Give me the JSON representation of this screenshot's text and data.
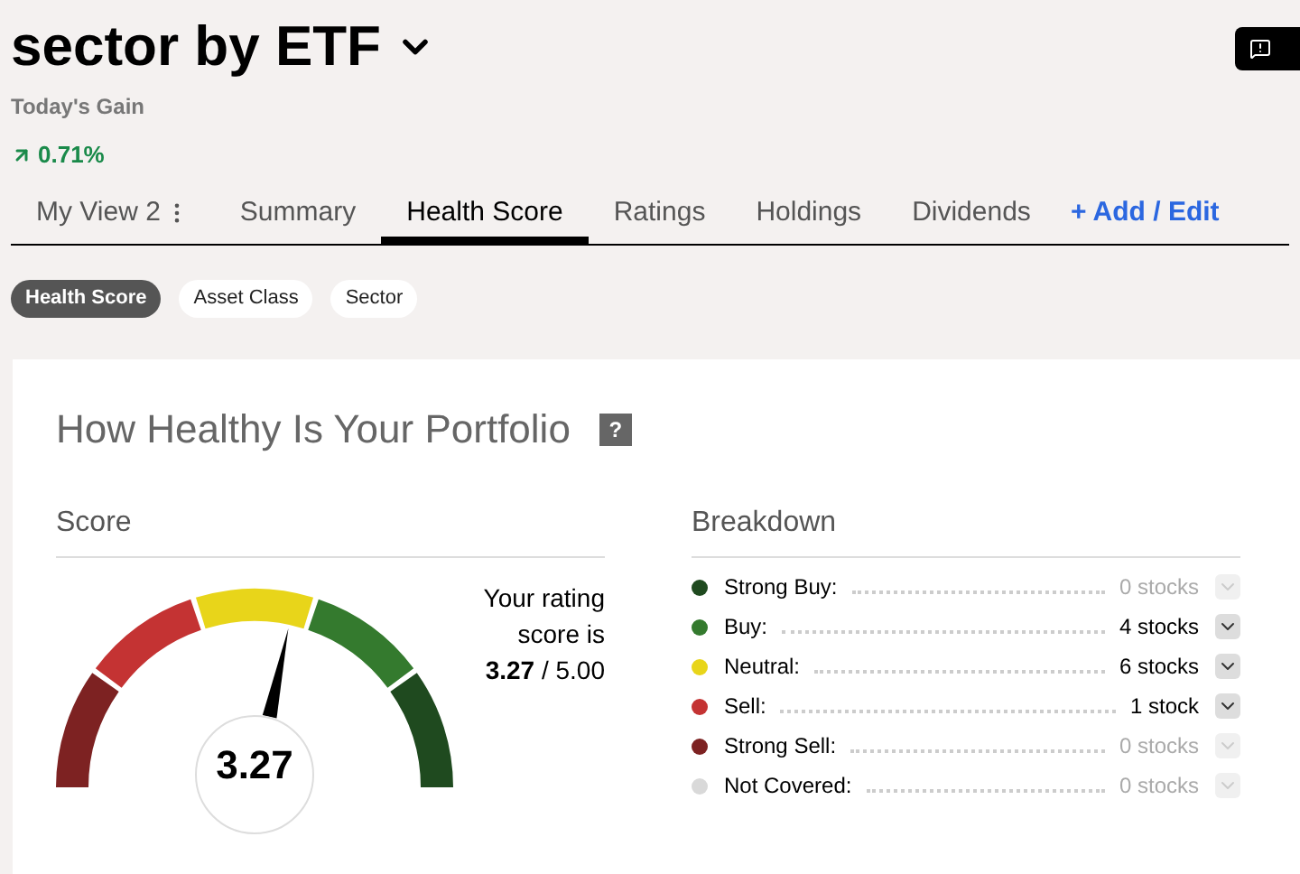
{
  "header": {
    "title": "sector by ETF",
    "gain_label": "Today's Gain",
    "gain_value": "0.71%"
  },
  "tabs": [
    {
      "label": "My View 2",
      "selected": false,
      "kind": "menu"
    },
    {
      "label": "Summary",
      "selected": false,
      "kind": "plain"
    },
    {
      "label": "Health Score",
      "selected": true,
      "kind": "plain"
    },
    {
      "label": "Ratings",
      "selected": false,
      "kind": "plain"
    },
    {
      "label": "Holdings",
      "selected": false,
      "kind": "plain"
    },
    {
      "label": "Dividends",
      "selected": false,
      "kind": "plain"
    }
  ],
  "add_edit": "+ Add / Edit",
  "chips": [
    {
      "label": "Health Score",
      "selected": true
    },
    {
      "label": "Asset Class",
      "selected": false
    },
    {
      "label": "Sector",
      "selected": false
    }
  ],
  "card": {
    "title": "How Healthy Is Your Portfolio",
    "help": "?",
    "score": {
      "heading": "Score",
      "value": "3.27",
      "rating_text": "Your rating score is",
      "rating_value": "3.27",
      "rating_max": "/ 5.00"
    },
    "breakdown": {
      "heading": "Breakdown",
      "rows": [
        {
          "label": "Strong Buy:",
          "count": "0 stocks",
          "color": "#1f4a1f",
          "disabled": true
        },
        {
          "label": "Buy:",
          "count": "4 stocks",
          "color": "#347a2e",
          "disabled": false
        },
        {
          "label": "Neutral:",
          "count": "6 stocks",
          "color": "#e8d51a",
          "disabled": false
        },
        {
          "label": "Sell:",
          "count": "1 stock",
          "color": "#c43333",
          "disabled": false
        },
        {
          "label": "Strong Sell:",
          "count": "0 stocks",
          "color": "#7d2222",
          "disabled": true
        },
        {
          "label": "Not Covered:",
          "count": "0 stocks",
          "color": "#d9d9d9",
          "disabled": true
        }
      ]
    }
  }
}
